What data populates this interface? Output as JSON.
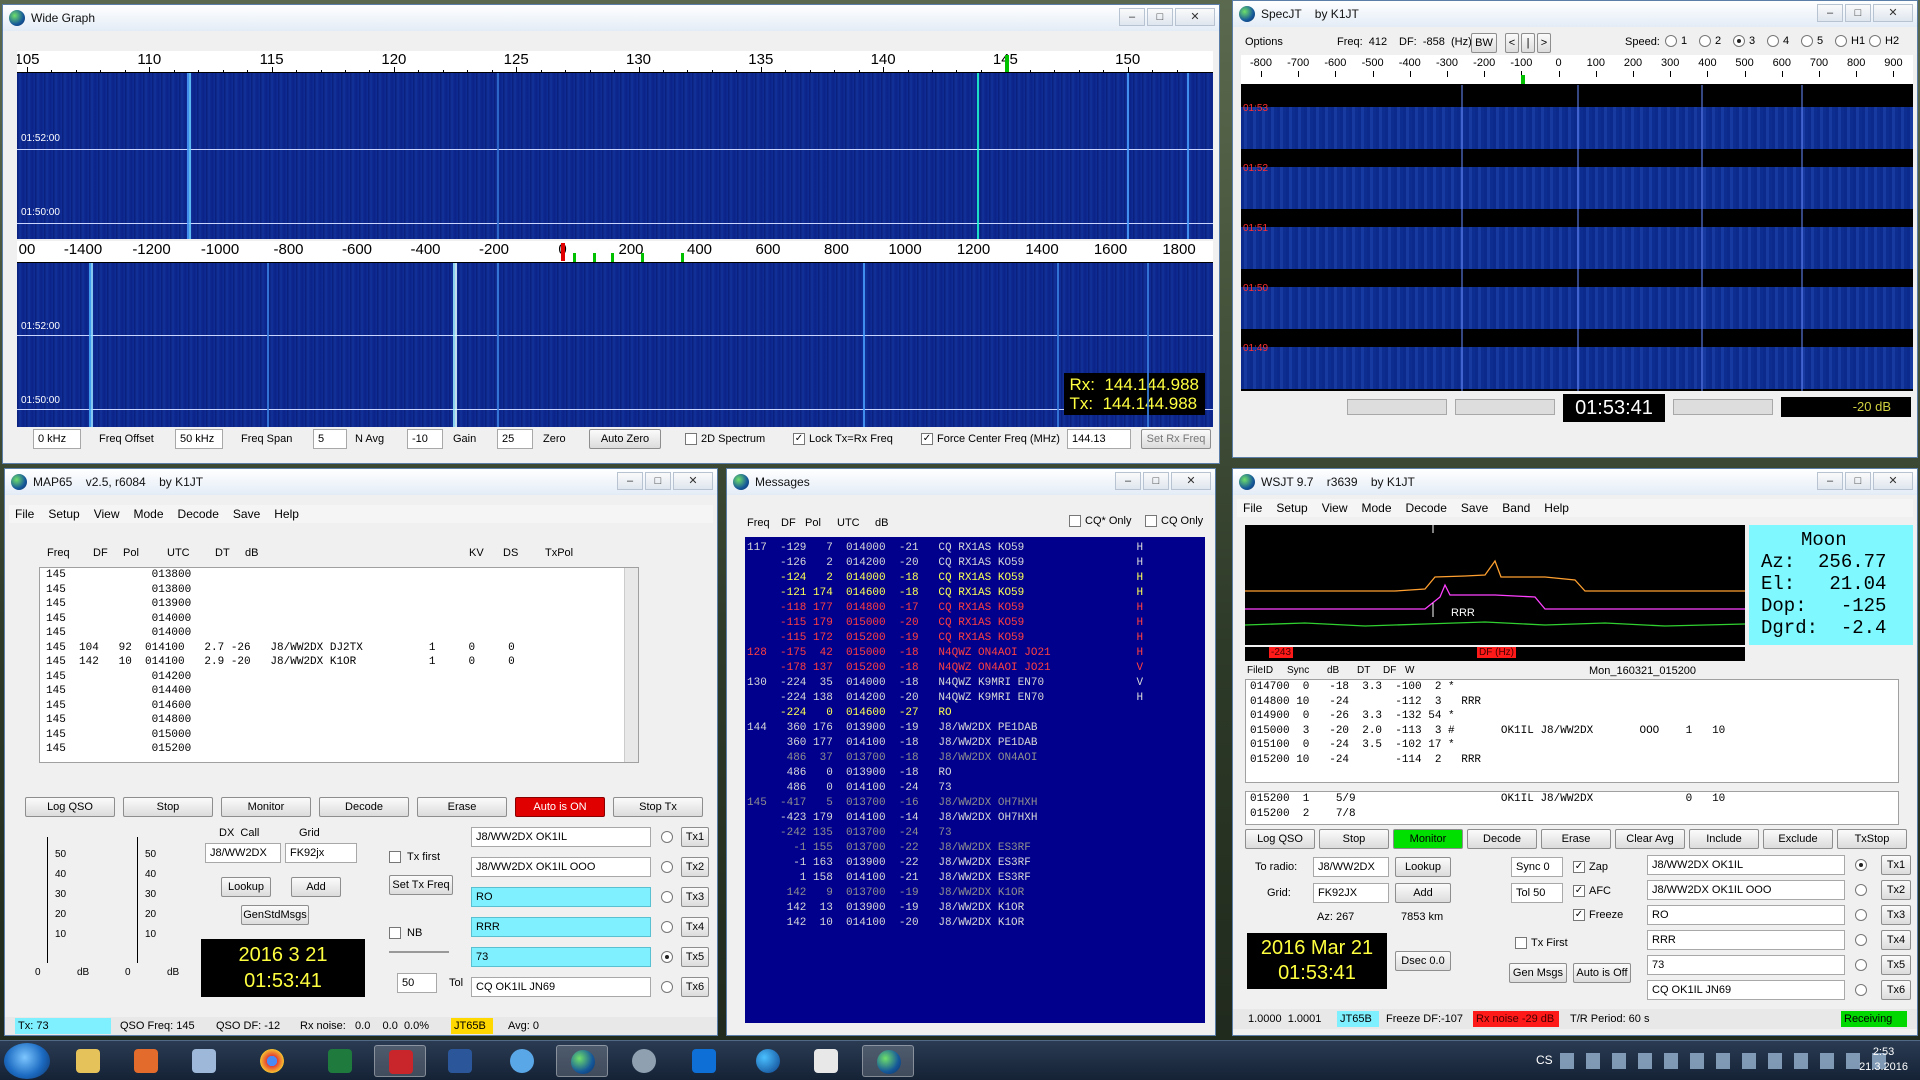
{
  "wide_graph": {
    "title": "Wide Graph",
    "top_scale_labels": [
      "105",
      "110",
      "115",
      "120",
      "125",
      "130",
      "135",
      "140",
      "145",
      "150"
    ],
    "top_times": [
      "01:52:00",
      "01:50:00"
    ],
    "bottom_scale_labels": [
      "00",
      "-1400",
      "-1200",
      "-1000",
      "-800",
      "-600",
      "-400",
      "-200",
      "0",
      "200",
      "400",
      "600",
      "800",
      "1000",
      "1200",
      "1400",
      "1600",
      "1800"
    ],
    "bottom_times": [
      "01:52:00",
      "01:50:00"
    ],
    "rx_freq": "Rx:  144.144.988",
    "tx_freq": "Tx:  144.144.988",
    "freq_offset_value": "0 kHz",
    "freq_offset_label": "Freq Offset",
    "freq_span_value": "50 kHz",
    "freq_span_label": "Freq Span",
    "navg_value": "5",
    "navg_label": "N Avg",
    "gain_value": "-10",
    "gain_label": "Gain",
    "zero_value": "25",
    "zero_label": "Zero",
    "auto_zero": "Auto Zero",
    "spectrum_2d": "2D Spectrum",
    "lock_tx": "Lock Tx=Rx Freq",
    "force_center": "Force Center Freq (MHz)",
    "center_freq": "144.13",
    "set_rx_freq": "Set Rx Freq"
  },
  "specjt": {
    "title": "SpecJT    by K1JT",
    "options": "Options",
    "freq": "Freq:  412",
    "df": "DF:  -858  (Hz)",
    "bw": "BW",
    "nav": [
      "<",
      "|",
      ">"
    ],
    "speed_label": "Speed:",
    "speeds": [
      "1",
      "2",
      "3",
      "4",
      "5",
      "H1",
      "H2"
    ],
    "speed_selected": "3",
    "scale_labels": [
      "-800",
      "-700",
      "-600",
      "-500",
      "-400",
      "-300",
      "-200",
      "-100",
      "0",
      "100",
      "200",
      "300",
      "400",
      "500",
      "600",
      "700",
      "800",
      "900"
    ],
    "minutes": [
      "01:53",
      "01:52",
      "01:51",
      "01:50",
      "01:49"
    ],
    "clock": "01:53:41",
    "level": "-20 dB"
  },
  "map65": {
    "title": "MAP65    v2.5, r6084    by K1JT",
    "menu": [
      "File",
      "Setup",
      "View",
      "Mode",
      "Decode",
      "Save",
      "Help"
    ],
    "headers": [
      "Freq",
      "DF",
      "Pol",
      "UTC",
      "DT",
      "dB",
      "KV",
      "DS",
      "TxPol"
    ],
    "rows": [
      "145             013800",
      "145             013800",
      "145             013900",
      "145             014000",
      "145             014000",
      "145  104   92  014100   2.7 -26   J8/WW2DX DJ2TX          1     0     0",
      "145  142   10  014100   2.9 -20   J8/WW2DX K1OR           1     0     0",
      "145             014200",
      "145             014400",
      "145             014600",
      "145             014800",
      "145             015000",
      "145             015200"
    ],
    "buttons": [
      "Log QSO",
      "Stop",
      "Monitor",
      "Decode",
      "Erase",
      "Auto is ON",
      "Stop Tx"
    ],
    "meter_labels": [
      "50",
      "40",
      "30",
      "20",
      "10",
      "0",
      "dB"
    ],
    "dx_call_label": "DX  Call",
    "grid_label": "Grid",
    "dx_call": "J8/WW2DX",
    "dx_grid": "FK92jx",
    "lookup": "Lookup",
    "add": "Add",
    "genstdmsgs": "GenStdMsgs",
    "date": "2016 3 21",
    "time": "01:53:41",
    "tx_first": "Tx first",
    "set_tx_freq": "Set Tx Freq",
    "nb": "NB",
    "tol_value": "50",
    "tol_label": "Tol",
    "tx_msgs": [
      "J8/WW2DX OK1IL",
      "J8/WW2DX OK1IL  OOO",
      "RO",
      "RRR",
      "73",
      "CQ OK1IL JN69"
    ],
    "tx_labels": [
      "Tx1",
      "Tx2",
      "Tx3",
      "Tx4",
      "Tx5",
      "Tx6"
    ],
    "tx_selected": "Tx5",
    "status": {
      "tx": "Tx: 73",
      "qso_freq": "QSO Freq: 145",
      "qso_df": "QSO DF:  -12",
      "rx_noise": "Rx noise:   0.0    0.0  0.0%",
      "mode": "JT65B",
      "avg": "Avg: 0"
    }
  },
  "messages": {
    "title": "Messages",
    "headers": [
      "Freq",
      "DF",
      "Pol",
      "UTC",
      "dB"
    ],
    "cq_star_only": "CQ* Only",
    "cq_only": "CQ Only",
    "rows": [
      {
        "t": "117  -129   7  014000  -21   CQ RX1AS KO59                 H",
        "c": "#d8d8d8"
      },
      {
        "t": "     -126   2  014200  -20   CQ RX1AS KO59                 H",
        "c": "#d8d8d8"
      },
      {
        "t": "     -124   2  014000  -18   CQ RX1AS KO59                 H",
        "c": "#ffff55"
      },
      {
        "t": "     -121 174  014600  -18   CQ RX1AS KO59                 H",
        "c": "#ffff55"
      },
      {
        "t": "     -118 177  014800  -17   CQ RX1AS KO59                 H",
        "c": "#ff4040"
      },
      {
        "t": "     -115 179  015000  -20   CQ RX1AS KO59                 H",
        "c": "#ff4040"
      },
      {
        "t": "     -115 172  015200  -19   CQ RX1AS KO59                 H",
        "c": "#ff4040"
      },
      {
        "t": "128  -175  42  015000  -18   N4QWZ ON4AOI JO21             H",
        "c": "#ff4040"
      },
      {
        "t": "     -178 137  015200  -18   N4QWZ ON4AOI JO21             V",
        "c": "#ff4040"
      },
      {
        "t": "130  -224  35  014000  -18   N4QWZ K9MRI EN70              V",
        "c": "#d8d8d8"
      },
      {
        "t": "     -224 138  014200  -20   N4QWZ K9MRI EN70              H",
        "c": "#d8d8d8"
      },
      {
        "t": "     -224   0  014600  -27   RO",
        "c": "#ffff55"
      },
      {
        "t": "144   360 176  013900  -19   J8/WW2DX PE1DAB",
        "c": "#d8d8d8"
      },
      {
        "t": "      360 177  014100  -18   J8/WW2DX PE1DAB",
        "c": "#d8d8d8"
      },
      {
        "t": "      486  37  013700  -18   J8/WW2DX ON4AOI",
        "c": "#8f8f8f"
      },
      {
        "t": "      486   0  013900  -18   RO",
        "c": "#d8d8d8"
      },
      {
        "t": "      486   0  014100  -24   73",
        "c": "#d8d8d8"
      },
      {
        "t": "145  -417   5  013700  -16   J8/WW2DX OH7HXH",
        "c": "#8f8f8f"
      },
      {
        "t": "     -423 179  014100  -14   J8/WW2DX OH7HXH",
        "c": "#d8d8d8"
      },
      {
        "t": "     -242 135  013700  -24   73",
        "c": "#8f8f8f"
      },
      {
        "t": "       -1 155  013700  -22   J8/WW2DX ES3RF",
        "c": "#8f8f8f"
      },
      {
        "t": "       -1 163  013900  -22   J8/WW2DX ES3RF",
        "c": "#d8d8d8"
      },
      {
        "t": "        1 158  014100  -21   J8/WW2DX ES3RF",
        "c": "#d8d8d8"
      },
      {
        "t": "      142   9  013700  -19   J8/WW2DX K1OR",
        "c": "#8f8f8f"
      },
      {
        "t": "      142  13  013900  -19   J8/WW2DX K1OR",
        "c": "#d8d8d8"
      },
      {
        "t": "      142  10  014100  -20   J8/WW2DX K1OR",
        "c": "#d8d8d8"
      }
    ]
  },
  "wsjt": {
    "title": "WSJT 9.7    r3639    by K1JT",
    "menu": [
      "File",
      "Setup",
      "View",
      "Mode",
      "Decode",
      "Save",
      "Band",
      "Help"
    ],
    "moon": [
      "Moon",
      "Az:  256.77",
      "El:   21.04",
      "Dop:   -125",
      "Dgrd:  -2.4"
    ],
    "marker_left": "-243",
    "marker_right": "DF (Hz)",
    "filename": "Mon_160321_015200",
    "headers": [
      "FileID",
      "Sync",
      "dB",
      "DT",
      "DF",
      "W"
    ],
    "rows": [
      "014700  0   -18  3.3  -100  2 *",
      "014800 10   -24       -112  3   RRR",
      "014900  0   -26  3.3  -132 54 *",
      "015000  3   -20  2.0  -113  3 #       OK1IL J8/WW2DX       OOO    1   10",
      "015100  0   -24  3.5  -102 17 *",
      "015200 10   -24       -114  2   RRR"
    ],
    "avg_rows": [
      "015200  1    5/9                      OK1IL J8/WW2DX              0   10",
      "015200  2    7/8"
    ],
    "buttons": [
      "Log QSO",
      "Stop",
      "Monitor",
      "Decode",
      "Erase",
      "Clear Avg",
      "Include",
      "Exclude",
      "TxStop"
    ],
    "to_radio_label": "To radio:",
    "to_radio": "J8/WW2DX",
    "grid_label": "Grid:",
    "grid": "FK92JX",
    "lookup": "Lookup",
    "add": "Add",
    "az": "Az: 267",
    "dist": "7853 km",
    "date": "2016 Mar 21",
    "time": "01:53:41",
    "dsec": "Dsec  0.0",
    "sync_label": "Sync  0",
    "tol_label": "Tol   50",
    "zap": "Zap",
    "afc": "AFC",
    "freeze": "Freeze",
    "tx_first": "Tx First",
    "gen_msgs": "Gen Msgs",
    "auto_off": "Auto is Off",
    "tx_msgs": [
      "J8/WW2DX OK1IL",
      "J8/WW2DX OK1IL OOO",
      "RO",
      "RRR",
      "73",
      "CQ OK1IL JN69"
    ],
    "tx_labels": [
      "Tx1",
      "Tx2",
      "Tx3",
      "Tx4",
      "Tx5",
      "Tx6"
    ],
    "status": {
      "ratio": "1.0000  1.0001",
      "mode": "JT65B",
      "freeze": "Freeze DF:-107",
      "rx_noise": "Rx noise -29 dB",
      "tr": "T/R Period: 60 s",
      "state": "Receiving"
    }
  },
  "taskbar": {
    "lang": "CS",
    "time": "2:53",
    "date": "21.3.2016"
  }
}
